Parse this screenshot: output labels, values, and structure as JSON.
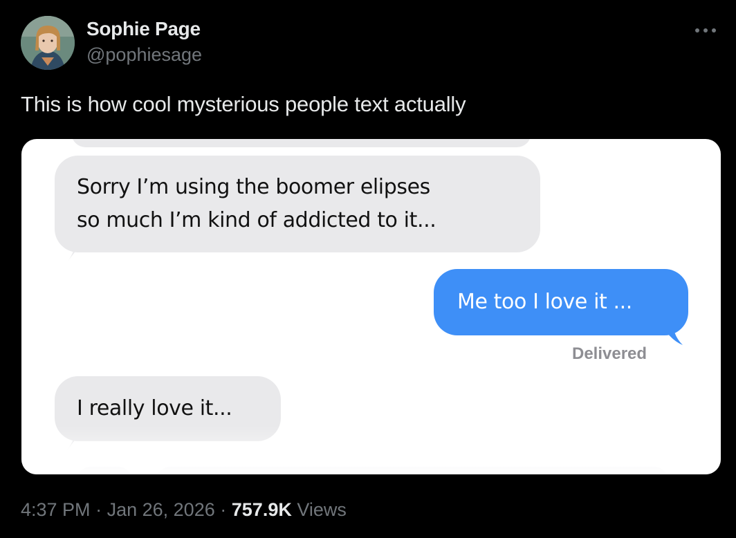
{
  "author": {
    "name": "Sophie Page",
    "handle": "@pophiesage"
  },
  "tweet": {
    "text": "This is how cool mysterious people text actually"
  },
  "media": {
    "messages": [
      {
        "direction": "received",
        "lines": [
          "Sorry I’m using the boomer elipses",
          "so much I’m kind of addicted to it..."
        ]
      },
      {
        "direction": "sent",
        "lines": [
          "Me too I love it ..."
        ]
      },
      {
        "direction": "received",
        "lines": [
          "I really love it..."
        ]
      }
    ],
    "status": "Delivered",
    "colors": {
      "received_bubble": "#e9e9eb",
      "sent_bubble": "#3e8ff7"
    }
  },
  "meta": {
    "time": "4:37 PM",
    "separator": "·",
    "date": "Jan 26, 2026",
    "views_count": "757.9K",
    "views_label": "Views"
  },
  "icons": {
    "more": "more-horizontal-icon"
  }
}
